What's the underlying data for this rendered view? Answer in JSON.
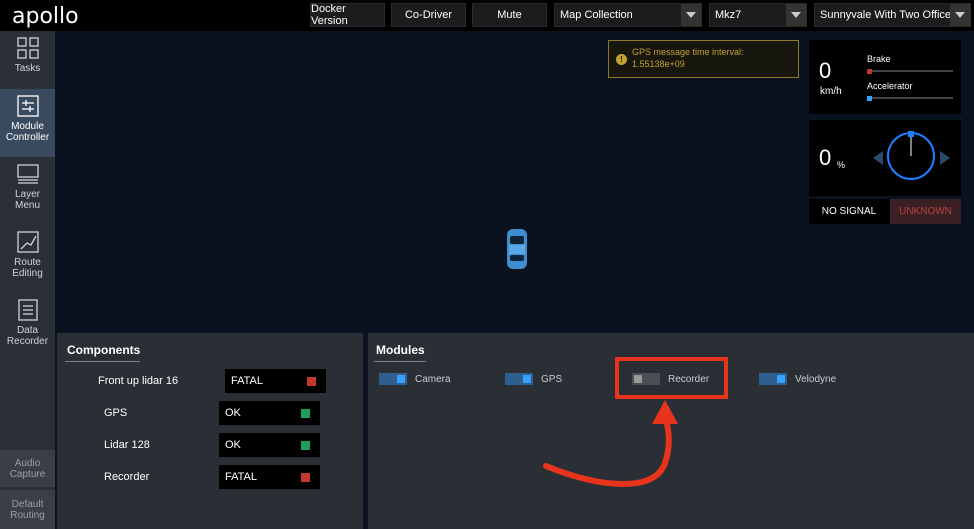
{
  "header": {
    "logo": "apollo",
    "docker_version": "Docker Version",
    "co_driver": "Co-Driver",
    "mute": "Mute",
    "mode_select": "Map Collection",
    "vehicle_select": "Mkz7",
    "map_select": "Sunnyvale With Two Offices"
  },
  "sidebar": {
    "items": [
      {
        "label_1": "Tasks",
        "label_2": "",
        "icon": "grid-icon"
      },
      {
        "label_1": "Module",
        "label_2": "Controller",
        "icon": "module-controller-icon"
      },
      {
        "label_1": "Layer",
        "label_2": "Menu",
        "icon": "layer-menu-icon"
      },
      {
        "label_1": "Route",
        "label_2": "Editing",
        "icon": "route-editing-icon"
      },
      {
        "label_1": "Data",
        "label_2": "Recorder",
        "icon": "data-recorder-icon"
      }
    ],
    "bottom": [
      {
        "label_1": "Audio",
        "label_2": "Capture"
      },
      {
        "label_1": "Default",
        "label_2": "Routing"
      }
    ]
  },
  "alert": {
    "line1": "GPS message time interval:",
    "line2": "1.55138e+09"
  },
  "dashboard": {
    "speed": "0",
    "speed_unit": "km/h",
    "brake_label": "Brake",
    "accelerator_label": "Accelerator",
    "steering": "0",
    "steering_unit": "%",
    "signal": "NO SIGNAL",
    "driving_mode": "UNKNOWN"
  },
  "components": {
    "title": "Components",
    "rows": [
      {
        "name": "Front up lidar 16",
        "status": "FATAL",
        "color": "#c0392b"
      },
      {
        "name": "GPS",
        "status": "OK",
        "color": "#1e9e5a"
      },
      {
        "name": "Lidar 128",
        "status": "OK",
        "color": "#1e9e5a"
      },
      {
        "name": "Recorder",
        "status": "FATAL",
        "color": "#c0392b"
      }
    ]
  },
  "modules": {
    "title": "Modules",
    "items": [
      {
        "name": "Camera",
        "enabled": true
      },
      {
        "name": "GPS",
        "enabled": true
      },
      {
        "name": "Recorder",
        "enabled": false
      },
      {
        "name": "Velodyne",
        "enabled": true
      }
    ]
  },
  "colors": {
    "accent": "#3aa0ff",
    "highlight": "#e8341c",
    "fatal": "#c0392b",
    "ok": "#1e9e5a"
  }
}
